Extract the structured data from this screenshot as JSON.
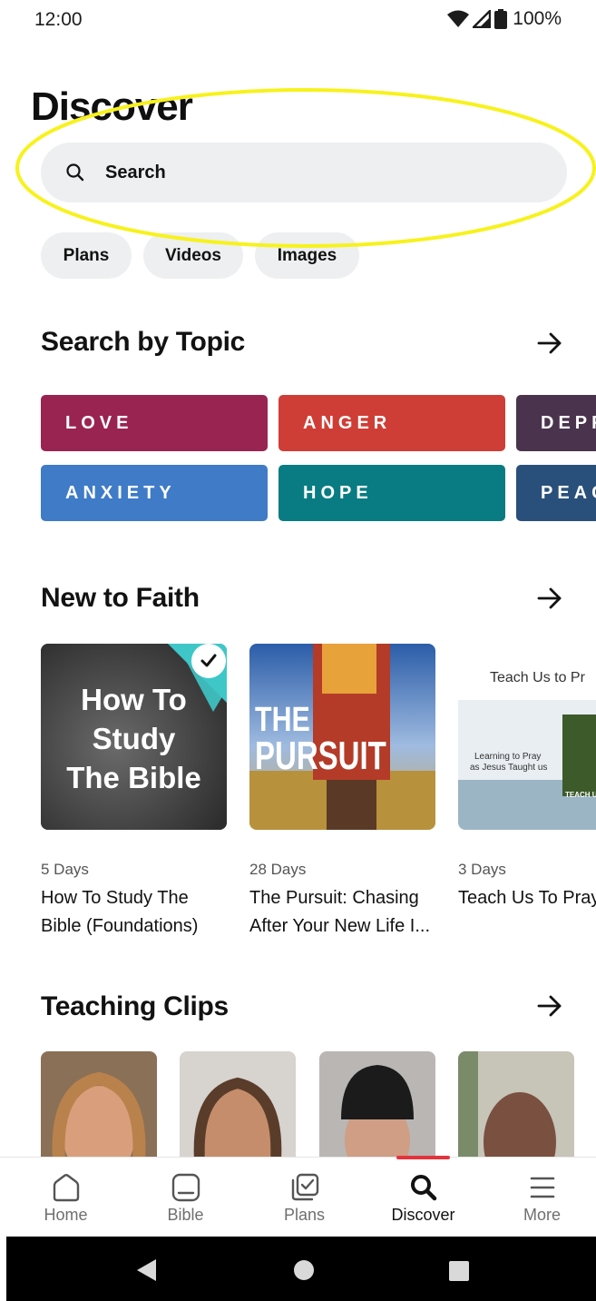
{
  "status_bar": {
    "time": "12:00",
    "battery": "100%"
  },
  "page_title": "Discover",
  "search": {
    "placeholder": "Search"
  },
  "chips": [
    "Plans",
    "Videos",
    "Images"
  ],
  "search_by_topic": {
    "title": "Search by Topic",
    "topics": [
      {
        "label": "LOVE",
        "color": "#9a2451"
      },
      {
        "label": "ANGER",
        "color": "#cf3e36"
      },
      {
        "label": "DEPR",
        "color": "#4a334d"
      },
      {
        "label": "ANXIETY",
        "color": "#3f7bc7"
      },
      {
        "label": "HOPE",
        "color": "#087c82"
      },
      {
        "label": "PEAC",
        "color": "#29507a"
      }
    ]
  },
  "new_to_faith": {
    "title": "New to Faith",
    "plans": [
      {
        "days": "5 Days",
        "title_line1": "How To Study The",
        "title_line2": "Bible (Foundations)",
        "image_text": [
          "How To",
          "Study",
          "The Bible"
        ]
      },
      {
        "days": "28 Days",
        "title_line1": "The Pursuit: Chasing",
        "title_line2": "After Your New Life I...",
        "image_text": [
          "THE",
          "PURSUIT"
        ]
      },
      {
        "days": "3 Days",
        "title_line1": "Teach Us To Pray",
        "title_line2": "",
        "image_text": [
          "Teach Us to Pr",
          "Learning to Pray",
          "as Jesus Taught us",
          "TEACH US"
        ]
      }
    ]
  },
  "teaching_clips": {
    "title": "Teaching Clips"
  },
  "bottom_nav": {
    "items": [
      {
        "label": "Home"
      },
      {
        "label": "Bible"
      },
      {
        "label": "Plans"
      },
      {
        "label": "Discover"
      },
      {
        "label": "More"
      }
    ],
    "accent_color": "#e3343d"
  },
  "colors": {
    "highlight": "#f7f21c",
    "chip_bg": "#edeff0"
  }
}
